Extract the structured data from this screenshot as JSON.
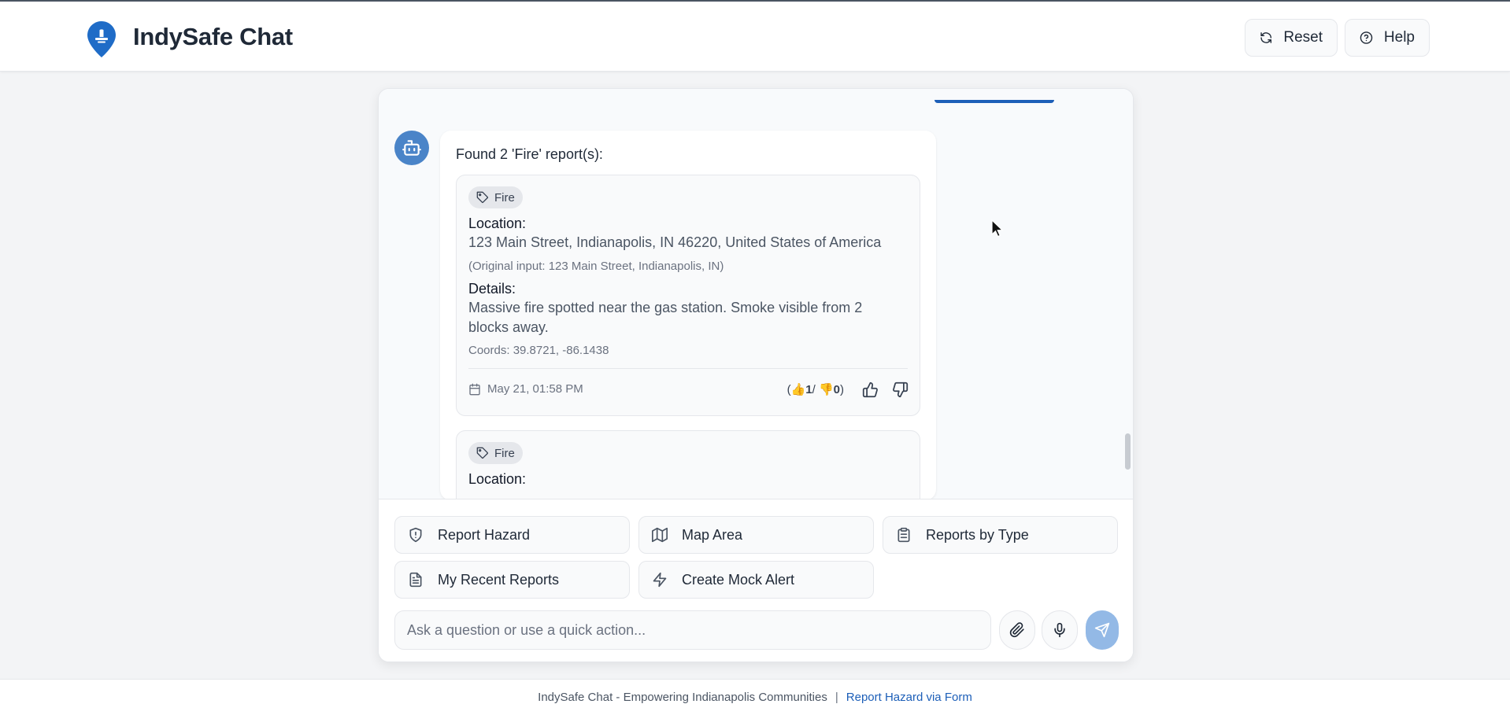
{
  "app": {
    "title": "IndySafe Chat",
    "brand_color": "#1f6cc7",
    "logo_icon": "map-pin-icon"
  },
  "header": {
    "reset_label": "Reset",
    "help_label": "Help"
  },
  "chat": {
    "bot_message": "Found 2 'Fire' report(s):",
    "reports": [
      {
        "category": "Fire",
        "location_label": "Location:",
        "location": "123 Main Street, Indianapolis, IN 46220, United States of America",
        "original_input": "(Original input: 123 Main Street, Indianapolis, IN)",
        "details_label": "Details:",
        "details": "Massive fire spotted near the gas station. Smoke visible from 2 blocks away.",
        "coords": "Coords: 39.8721, -86.1438",
        "date": "May 21, 01:58 PM",
        "votes_open": "(",
        "upvote_emoji": "👍",
        "upvotes": "1",
        "votes_sep": "/",
        "downvote_emoji": "👎",
        "downvotes": "0",
        "votes_close": ")"
      },
      {
        "category": "Fire",
        "location_label": "Location:"
      }
    ]
  },
  "quick_actions": [
    {
      "label": "Report Hazard",
      "icon": "shield-alert-icon"
    },
    {
      "label": "Map Area",
      "icon": "map-icon"
    },
    {
      "label": "Reports by Type",
      "icon": "clipboard-icon"
    },
    {
      "label": "My Recent Reports",
      "icon": "file-text-icon"
    },
    {
      "label": "Create Mock Alert",
      "icon": "zap-icon"
    }
  ],
  "composer": {
    "placeholder": "Ask a question or use a quick action...",
    "value": ""
  },
  "footer": {
    "tagline": "IndySafe Chat - Empowering Indianapolis Communities",
    "separator": "|",
    "link_label": "Report Hazard via Form"
  },
  "colors": {
    "accent": "#1f6cc7",
    "bot_avatar": "#4a84c8",
    "send_button_disabled": "#93b9e6",
    "link": "#1d5fb8"
  }
}
